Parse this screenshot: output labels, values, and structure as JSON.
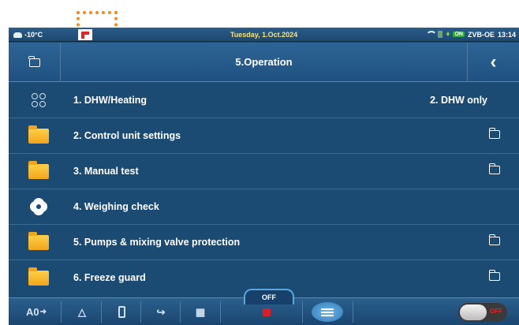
{
  "status": {
    "temperature": "-10°C",
    "date": "Tuesday, 1.Oct.2024",
    "on_badge": "ON",
    "device_name": "ZVB-OE",
    "time": "13:14"
  },
  "header": {
    "title": "5.Operation",
    "back_glyph": "‹"
  },
  "menu": {
    "items": [
      {
        "label": "1. DHW/Heating",
        "value": "2. DHW only",
        "icon": "circles-grid-icon"
      },
      {
        "label": "2. Control unit settings",
        "icon": "yellow-folder-icon",
        "has_folder": true
      },
      {
        "label": "3. Manual test",
        "icon": "yellow-folder-icon",
        "has_folder": true
      },
      {
        "label": "4. Weighing check",
        "icon": "gear-icon"
      },
      {
        "label": "5. Pumps & mixing valve protection",
        "icon": "yellow-folder-icon",
        "has_folder": true
      },
      {
        "label": "6. Freeze guard",
        "icon": "yellow-folder-icon",
        "has_folder": true
      }
    ]
  },
  "toolbar": {
    "auto_label": "A0",
    "off_tab_label": "OFF",
    "toggle_label": "OFF"
  }
}
